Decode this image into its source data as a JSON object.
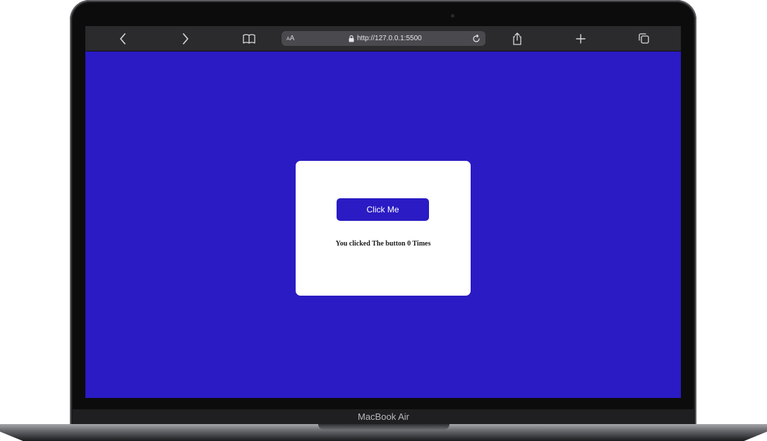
{
  "device": {
    "model_label": "MacBook Air"
  },
  "browser": {
    "reader_aa": "AA",
    "url": "http://127.0.0.1:5500",
    "icons": [
      "back-arrow-icon",
      "forward-arrow-icon",
      "bookmarks-book-icon",
      "lock-icon",
      "reload-icon",
      "share-icon",
      "new-tab-plus-icon",
      "tabs-overview-icon"
    ]
  },
  "page": {
    "background_color": "#2a1bc4",
    "card_color": "#ffffff",
    "button_label": "Click Me",
    "count_text": "You clicked The button 0 Times"
  }
}
